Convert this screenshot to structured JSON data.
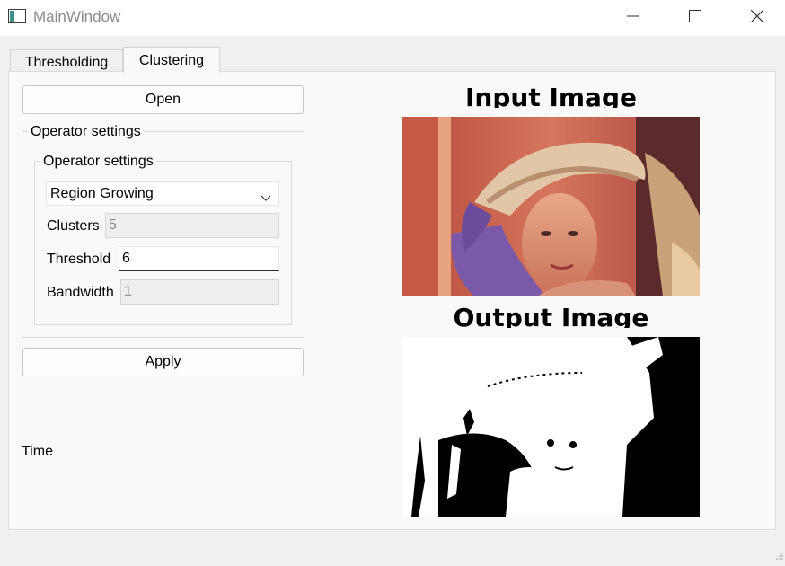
{
  "window": {
    "title": "MainWindow"
  },
  "tabs": [
    {
      "label": "Thresholding",
      "active": false
    },
    {
      "label": "Clustering",
      "active": true
    }
  ],
  "buttons": {
    "open_label": "Open",
    "apply_label": "Apply"
  },
  "operator_settings": {
    "outer_title": "Operator settings",
    "inner_title": "Operator settings",
    "method": "Region Growing",
    "clusters": {
      "label": "Clusters",
      "value": "5",
      "enabled": false
    },
    "threshold": {
      "label": "Threshold",
      "value": "6",
      "enabled": true
    },
    "bandwidth": {
      "label": "Bandwidth",
      "value": "1",
      "enabled": false
    }
  },
  "time": {
    "label": "Time"
  },
  "images": {
    "input_title": "Input Image",
    "output_title": "Output Image"
  },
  "icons": {
    "app": "window-app-icon",
    "minimize": "minimize-icon",
    "maximize": "maximize-icon",
    "close": "close-icon",
    "combo": "chevron-down-icon"
  }
}
